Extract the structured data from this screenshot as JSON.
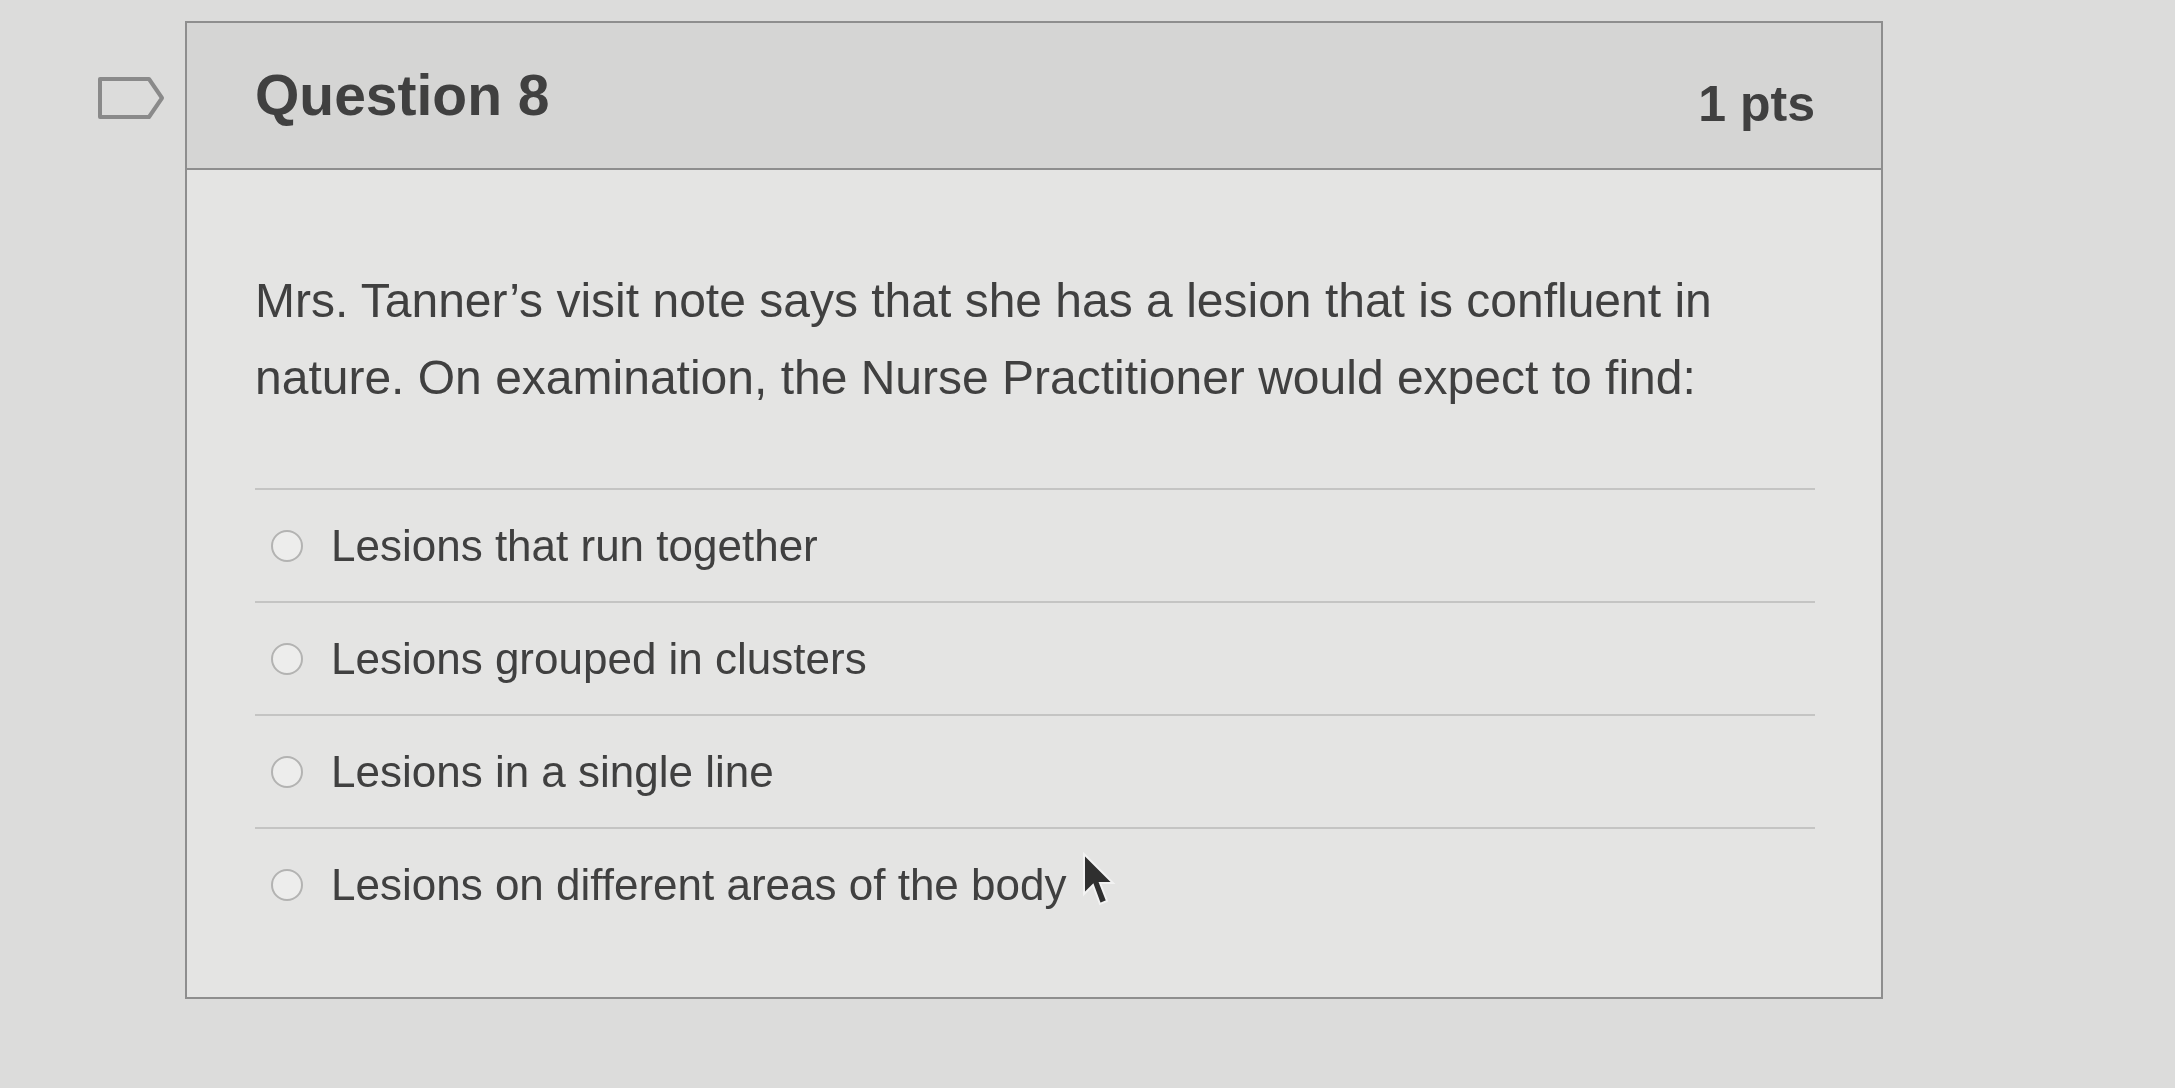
{
  "flag_marker": {
    "flagged": false
  },
  "question": {
    "title": "Question 8",
    "points": "1 pts",
    "text": "Mrs. Tanner’s visit note says that she has a lesion that is confluent in nature. On examination, the Nurse Practitioner would expect to find:",
    "answers": [
      {
        "label": "Lesions that run together",
        "selected": false
      },
      {
        "label": "Lesions grouped in clusters",
        "selected": false
      },
      {
        "label": "Lesions in a single line",
        "selected": false
      },
      {
        "label": "Lesions on different areas of the body",
        "selected": false
      }
    ]
  }
}
